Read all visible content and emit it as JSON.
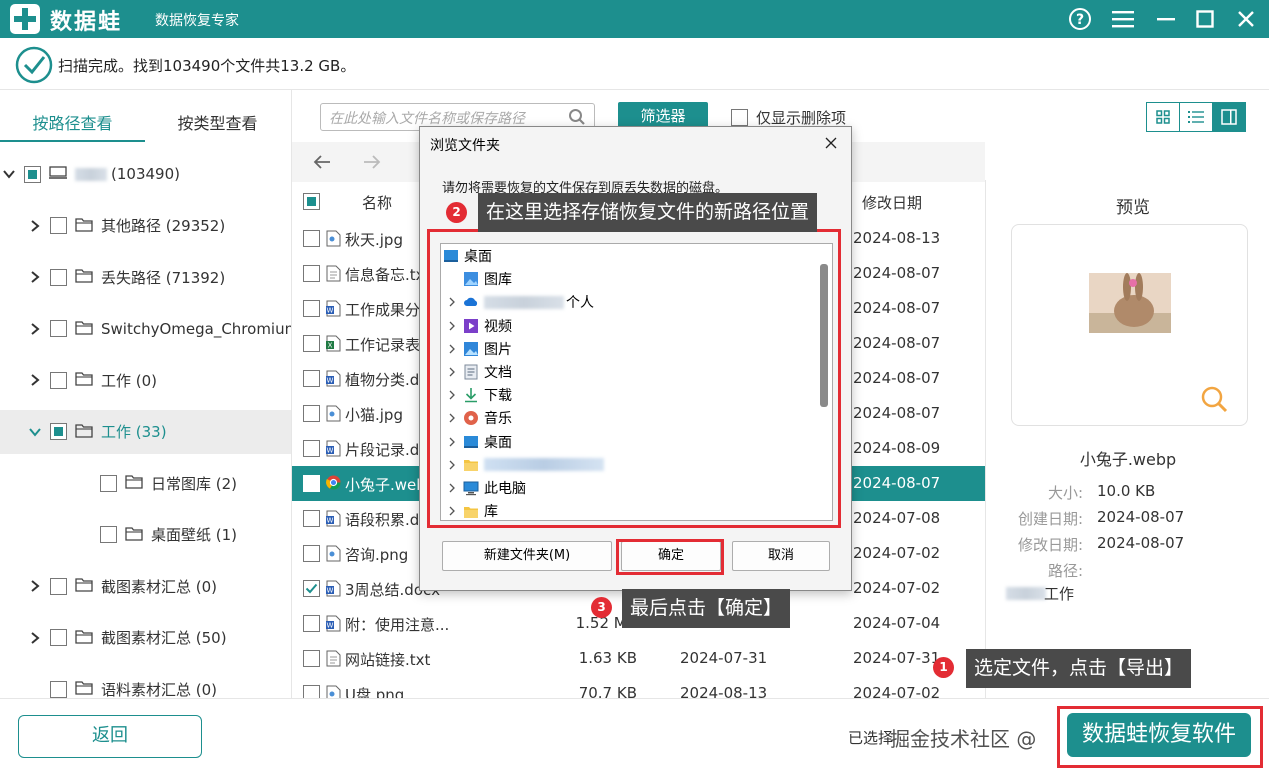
{
  "app": {
    "name": "数据蛙",
    "subtitle": "数据恢复专家",
    "accent": "#1d8f8e"
  },
  "status": {
    "text": "扫描完成。找到103490个文件共13.2 GB。"
  },
  "left_tabs": [
    "按路径查看",
    "按类型查看"
  ],
  "tree": [
    {
      "label": "(103490)",
      "level": 0,
      "expanded": true,
      "check": "part",
      "icon": "drive-icon"
    },
    {
      "label": "其他路径 (29352)",
      "level": 1,
      "expanded": false,
      "check": "none",
      "icon": "folder-icon"
    },
    {
      "label": "丢失路径 (71392)",
      "level": 1,
      "expanded": false,
      "check": "none",
      "icon": "folder-icon"
    },
    {
      "label": "SwitchyOmega_Chromium",
      "level": 1,
      "expanded": false,
      "check": "none",
      "icon": "folder-icon"
    },
    {
      "label": "工作 (0)",
      "level": 1,
      "expanded": false,
      "check": "none",
      "icon": "folder-icon"
    },
    {
      "label": "工作 (33)",
      "level": 1,
      "expanded": true,
      "check": "part",
      "icon": "folder-icon",
      "selected": true
    },
    {
      "label": "日常图库 (2)",
      "level": 2,
      "expanded": null,
      "check": "none",
      "icon": "folder-icon"
    },
    {
      "label": "桌面壁纸 (1)",
      "level": 2,
      "expanded": null,
      "check": "none",
      "icon": "folder-icon"
    },
    {
      "label": "截图素材汇总 (0)",
      "level": 1,
      "expanded": false,
      "check": "none",
      "icon": "folder-icon"
    },
    {
      "label": "截图素材汇总 (50)",
      "level": 1,
      "expanded": false,
      "check": "none",
      "icon": "folder-icon"
    },
    {
      "label": "语料素材汇总 (0)",
      "level": 1,
      "expanded": null,
      "check": "none",
      "icon": "folder-icon"
    }
  ],
  "toolbar": {
    "search_placeholder": "在此处输入文件名称或保存路径",
    "filter_label": "筛选器",
    "only_deleted_label": "仅显示删除项"
  },
  "list_header": {
    "name": "名称",
    "mdate": "修改日期"
  },
  "files": [
    {
      "name": "秋天.jpg",
      "size": "",
      "cdate": "",
      "mdate": "2024-08-13",
      "icon": "image-file-icon",
      "checked": false
    },
    {
      "name": "信息备忘.txt",
      "size": "",
      "cdate": "",
      "mdate": "2024-08-07",
      "icon": "text-file-icon",
      "checked": false
    },
    {
      "name": "工作成果分",
      "size": "",
      "cdate": "",
      "mdate": "2024-08-07",
      "icon": "word-file-icon",
      "checked": false
    },
    {
      "name": "工作记录表",
      "size": "",
      "cdate": "",
      "mdate": "2024-08-07",
      "icon": "excel-file-icon",
      "checked": false
    },
    {
      "name": "植物分类.d",
      "size": "",
      "cdate": "",
      "mdate": "2024-08-07",
      "icon": "word-file-icon",
      "checked": false
    },
    {
      "name": "小猫.jpg",
      "size": "",
      "cdate": "",
      "mdate": "2024-08-07",
      "icon": "image-file-icon",
      "checked": false
    },
    {
      "name": "片段记录.d",
      "size": "",
      "cdate": "",
      "mdate": "2024-08-09",
      "icon": "word-file-icon",
      "checked": false
    },
    {
      "name": "小兔子.web",
      "size": "",
      "cdate": "",
      "mdate": "2024-08-07",
      "icon": "chrome-file-icon",
      "checked": false,
      "selected": true
    },
    {
      "name": "语段积累.d",
      "size": "",
      "cdate": "",
      "mdate": "2024-07-08",
      "icon": "word-file-icon",
      "checked": false
    },
    {
      "name": "咨询.png",
      "size": "",
      "cdate": "",
      "mdate": "2024-07-02",
      "icon": "image-file-icon",
      "checked": false
    },
    {
      "name": "3周总结.docx",
      "size": "",
      "cdate": "",
      "mdate": "2024-07-02",
      "icon": "word-file-icon",
      "checked": true
    },
    {
      "name": "附：使用注意...",
      "size": "1.52 MB",
      "cdate": "2024-08-13",
      "mdate": "2024-07-04",
      "icon": "word-file-icon",
      "checked": false
    },
    {
      "name": "网站链接.txt",
      "size": "1.63 KB",
      "cdate": "2024-07-31",
      "mdate": "2024-07-31",
      "icon": "text-file-icon",
      "checked": false
    },
    {
      "name": "U盘.png",
      "size": "70.7 KB",
      "cdate": "2024-08-13",
      "mdate": "2024-07-02",
      "icon": "image-file-icon",
      "checked": false
    }
  ],
  "preview": {
    "title": "预览",
    "filename": "小兔子.webp",
    "size_label": "大小:",
    "size": "10.0 KB",
    "created_label": "创建日期:",
    "created": "2024-08-07",
    "modified_label": "修改日期:",
    "modified": "2024-08-07",
    "path_label": "路径:",
    "path": "工作"
  },
  "bottom": {
    "back_label": "返回",
    "selected_info": "已选择",
    "export_label": "数据蛙恢复软件",
    "watermark": "掘金技术社区 @"
  },
  "dialog": {
    "title": "浏览文件夹",
    "message": "请勿将需要恢复的文件保存到原丢失数据的磁盘。",
    "nodes": [
      {
        "label": "桌面",
        "indent": 0,
        "chev": false,
        "icon": "desktop-icon"
      },
      {
        "label": "图库",
        "indent": 1,
        "chev": false,
        "icon": "gallery-icon"
      },
      {
        "label": "个人",
        "indent": 1,
        "chev": true,
        "icon": "cloud-icon",
        "blurred": true
      },
      {
        "label": "视频",
        "indent": 1,
        "chev": true,
        "icon": "video-icon"
      },
      {
        "label": "图片",
        "indent": 1,
        "chev": true,
        "icon": "pictures-icon"
      },
      {
        "label": "文档",
        "indent": 1,
        "chev": true,
        "icon": "documents-icon"
      },
      {
        "label": "下载",
        "indent": 1,
        "chev": true,
        "icon": "download-icon"
      },
      {
        "label": "音乐",
        "indent": 1,
        "chev": true,
        "icon": "music-icon"
      },
      {
        "label": "桌面",
        "indent": 1,
        "chev": true,
        "icon": "desktop-icon"
      },
      {
        "label": "",
        "indent": 1,
        "chev": true,
        "icon": "folder-icon",
        "blurred": true
      },
      {
        "label": "此电脑",
        "indent": 1,
        "chev": true,
        "icon": "computer-icon"
      },
      {
        "label": "库",
        "indent": 1,
        "chev": true,
        "icon": "library-icon"
      }
    ],
    "new_folder_label": "新建文件夹(M)",
    "ok_label": "确定",
    "cancel_label": "取消"
  },
  "annotations": [
    {
      "num": "1",
      "text": "选定文件，点击【导出】"
    },
    {
      "num": "2",
      "text": "在这里选择存储恢复文件的新路径位置"
    },
    {
      "num": "3",
      "text": "最后点击【确定】"
    }
  ],
  "annotation_color": "#e32c34"
}
